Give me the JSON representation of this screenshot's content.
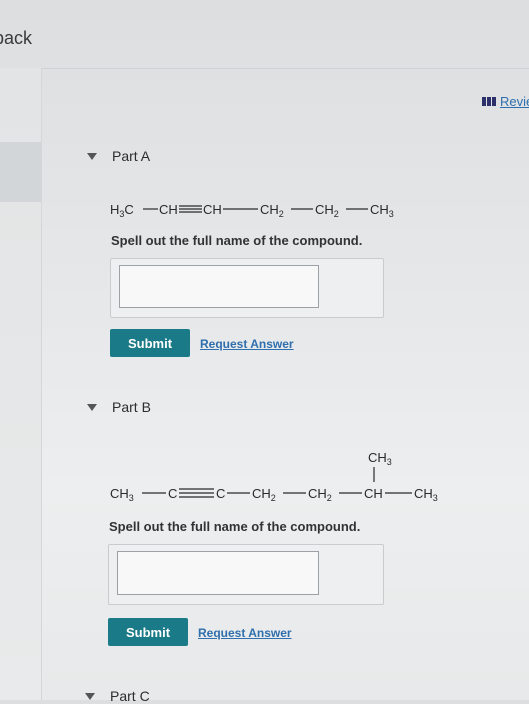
{
  "nav": {
    "back_label": "back",
    "review_label": "Revie"
  },
  "partA": {
    "label": "Part A",
    "formula": {
      "t0": "H",
      "s0": "3",
      "t1": "C",
      "t2": "CH",
      "t3": "CH",
      "t4": "CH",
      "s4": "2",
      "t5": "CH",
      "s5": "2",
      "t6": "CH",
      "s6": "3"
    },
    "instruction": "Spell out the full name of the compound.",
    "answer_value": "",
    "submit_label": "Submit",
    "request_label": "Request Answer"
  },
  "partB": {
    "label": "Part B",
    "formula": {
      "branch": "CH",
      "sbranch": "3",
      "t0": "CH",
      "s0": "3",
      "t1": "C",
      "t2": "C",
      "t3": "CH",
      "s3": "2",
      "t4": "CH",
      "s4": "2",
      "t5": "CH",
      "t6": "CH",
      "s6": "3"
    },
    "instruction": "Spell out the full name of the compound.",
    "answer_value": "",
    "submit_label": "Submit",
    "request_label": "Request Answer"
  },
  "partC": {
    "label": "Part C"
  },
  "colors": {
    "accent": "#1b7a87",
    "link": "#2f6fad"
  },
  "icons": {
    "review": "review-list-icon",
    "caret": "caret-down-icon"
  }
}
